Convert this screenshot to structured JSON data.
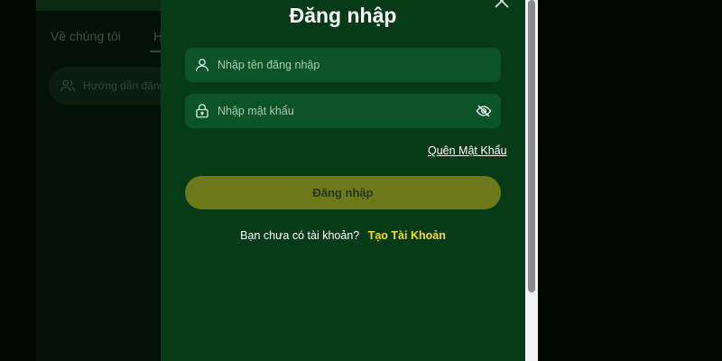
{
  "background": {
    "nav_about": "Về chúng tôi",
    "nav_partial": "H",
    "guide_partial": "Hướng dẫn đăng"
  },
  "modal": {
    "title": "Đăng nhập",
    "username_placeholder": "Nhập tên đăng nhập",
    "password_placeholder": "Nhập mật khẩu",
    "forgot_password": "Quên Mật Khẩu",
    "login_button": "Đăng nhập",
    "no_account_text": "Bạn chưa có tài khoản?",
    "create_account": "Tạo Tài Khoản"
  },
  "icons": {
    "user": "user-icon",
    "lock": "lock-icon",
    "eye": "eye-off-icon",
    "close": "close-icon"
  },
  "colors": {
    "modal_bg": "#073b18",
    "field_bg": "#0a5428",
    "button_bg": "#6e7a1a",
    "link_accent": "#f4dc2a"
  }
}
